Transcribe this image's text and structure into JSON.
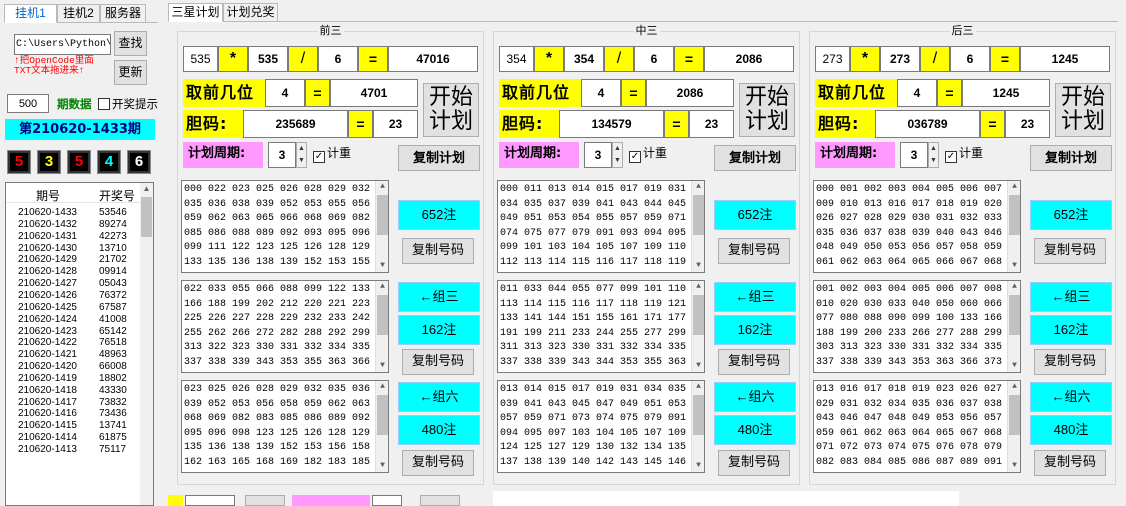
{
  "left_tabs": [
    "挂机1",
    "挂机2",
    "服务器"
  ],
  "path_value": "C:\\Users\\Python\\D",
  "find_label": "查找",
  "hint_line1": "↑把OpenCode里面",
  "hint_line2": "TXT文本拖进来↑",
  "update_label": "更新",
  "count_value": "500",
  "period_data_label": "期数据",
  "prize_tip_label": "开奖提示",
  "period_label": "第210620-1433期",
  "draw_numbers": [
    "5",
    "3",
    "5",
    "4",
    "6"
  ],
  "draw_colors": [
    "#ff0000",
    "#ffff00",
    "#ff0000",
    "#00ffff",
    "#ffffff"
  ],
  "list_headers": [
    "期号",
    "开奖号"
  ],
  "history": [
    [
      "210620-1433",
      "53546"
    ],
    [
      "210620-1432",
      "89274"
    ],
    [
      "210620-1431",
      "42273"
    ],
    [
      "210620-1430",
      "13710"
    ],
    [
      "210620-1429",
      "21702"
    ],
    [
      "210620-1428",
      "09914"
    ],
    [
      "210620-1427",
      "05043"
    ],
    [
      "210620-1426",
      "76372"
    ],
    [
      "210620-1425",
      "67587"
    ],
    [
      "210620-1424",
      "41008"
    ],
    [
      "210620-1423",
      "65142"
    ],
    [
      "210620-1422",
      "76518"
    ],
    [
      "210620-1421",
      "48963"
    ],
    [
      "210620-1420",
      "66008"
    ],
    [
      "210620-1419",
      "18802"
    ],
    [
      "210620-1418",
      "43330"
    ],
    [
      "210620-1417",
      "73832"
    ],
    [
      "210620-1416",
      "73436"
    ],
    [
      "210620-1415",
      "13741"
    ],
    [
      "210620-1414",
      "61875"
    ],
    [
      "210620-1413",
      "75117"
    ]
  ],
  "main_tabs": [
    "三星计划",
    "计划兑奖"
  ],
  "labels": {
    "take_front": "取前几位",
    "dan": "胆码:",
    "cycle": "计划周期:",
    "start": "开始",
    "plan": "计划",
    "weight": "计重",
    "copy_plan": "复制计划",
    "copy_code": "复制号码",
    "group3": "←组三",
    "group6": "←组六",
    "star": "*",
    "slash": "/",
    "eq": "="
  },
  "groups": [
    {
      "title": "前三",
      "a": "535",
      "b": "535",
      "c": "6",
      "d": "47016",
      "front": "4",
      "front_res": "4701",
      "dan": "235689",
      "dan_res": "23",
      "cycle": "3",
      "count1": "652注",
      "count2": "162注",
      "count3": "480注",
      "t1": "000 022 023 025 026 028 029 032 033\n035 036 038 039 052 053 055 056 058\n059 062 063 065 066 068 069 082 083\n085 086 088 089 092 093 095 096 098\n099 111 122 123 125 126 128 129 132\n133 135 136 138 139 152 153 155 156\n156 158 159 162 163 165 166 168 169",
      "t2": "022 033 055 066 088 099 122 133 155\n166 188 199 202 212 220 221 223 224\n225 226 227 228 229 232 233 242 252\n255 262 266 272 282 288 292 299 303\n313 322 323 330 331 332 334 335 336\n337 338 339 343 353 355 363 366 373\n377 383 388 393 399 404 433 455 466",
      "t3": "023 025 026 028 029 032 035 036 038\n039 052 053 056 058 059 062 063 065\n068 069 082 083 085 086 089 092 093\n095 096 098 123 125 126 128 129 132\n135 136 138 139 152 153 156 158 159\n162 163 165 168 169 182 183 185 186\n189 192 193 195 196 198 203 205 206"
    },
    {
      "title": "中三",
      "a": "354",
      "b": "354",
      "c": "6",
      "d": "2086",
      "front": "4",
      "front_res": "2086",
      "dan": "134579",
      "dan_res": "23",
      "cycle": "3",
      "count1": "652注",
      "count2": "162注",
      "count3": "480注",
      "t1": "000 011 013 014 015 017 019 031 033\n034 035 037 039 041 043 044 045 047\n049 051 053 054 055 057 059 071 073\n074 075 077 079 091 093 094 095 097\n099 101 103 104 105 107 109 110 111\n112 113 114 115 116 117 118 119 121\n123 124 125 127 129 130 131 133 134",
      "t2": "011 033 044 055 077 099 101 110 112\n113 114 115 116 117 118 119 121 131\n133 141 144 151 155 161 171 177 181\n191 199 211 233 244 255 277 299 303\n311 313 323 330 331 332 334 335 336\n337 338 339 343 344 353 355 363 373\n377 383 393 399 404 411 414 433 440",
      "t3": "013 014 015 017 019 031 034 035 037\n039 041 043 045 047 049 051 053 054\n057 059 071 073 074 075 079 091 093\n094 095 097 103 104 105 107 109 123\n124 125 127 129 130 132 134 135 136\n137 138 139 140 142 143 145 146 147\n149 150 152 153 154 156 157 158 159"
    },
    {
      "title": "后三",
      "a": "273",
      "b": "273",
      "c": "6",
      "d": "1245",
      "front": "4",
      "front_res": "1245",
      "dan": "036789",
      "dan_res": "23",
      "cycle": "3",
      "count1": "652注",
      "count2": "162注",
      "count3": "480注",
      "t1": "000 001 002 003 004 005 006 007 008\n009 010 013 016 017 018 019 020 023\n026 027 028 029 030 031 032 033 034\n035 036 037 038 039 040 043 046 047\n048 049 050 053 056 057 058 059 060\n061 062 063 064 065 066 067 068 069\n070 073 076 077 078 079 080 083 086",
      "t2": "001 002 003 004 005 006 007 008 009\n010 020 030 033 040 050 060 066 070\n077 080 088 090 099 100 133 166 177\n188 199 200 233 266 277 288 299 300\n303 313 323 330 331 332 334 335 336\n337 338 339 343 353 363 366 373 377\n383 388 393 399 400 433 466 477 488",
      "t3": "013 016 017 018 019 023 026 027 028\n029 031 032 034 035 036 037 038 039\n043 046 047 048 049 053 056 057 058\n059 061 062 063 064 065 067 068 069\n071 072 073 074 075 076 078 079 081\n082 083 084 085 086 087 089 091 092\n093 094 095 096 097 098 103 106 107"
    }
  ]
}
